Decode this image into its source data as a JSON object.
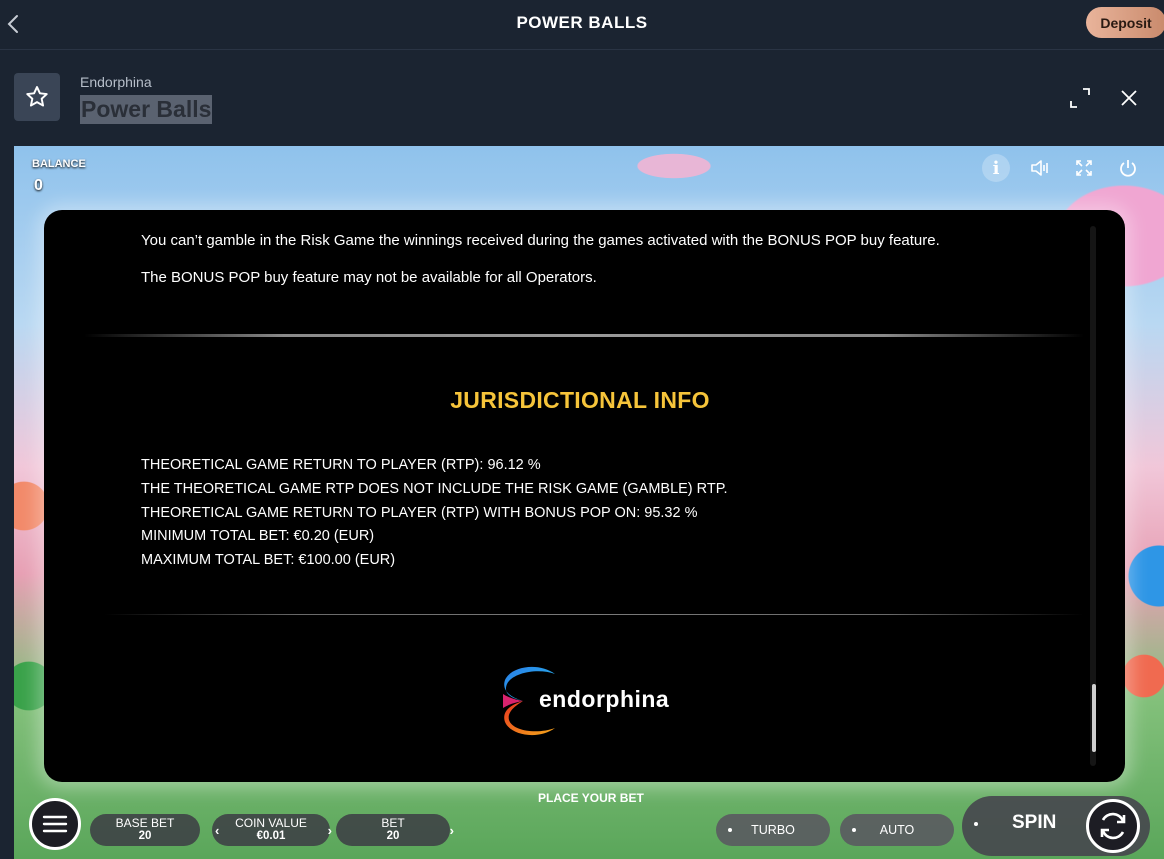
{
  "topbar": {
    "title": "POWER BALLS",
    "deposit_label": "Deposit"
  },
  "header": {
    "provider": "Endorphina",
    "game_name": "Power Balls"
  },
  "game": {
    "balance_label": "BALANCE",
    "balance_value": "0",
    "info_icon_glyph": "i"
  },
  "modal": {
    "paragraphs": [
      "You can’t gamble in the Risk Game the winnings received during the games activated with the BONUS POP buy feature.",
      "The BONUS POP buy feature may not be available for all Operators."
    ],
    "section_title": "JURISDICTIONAL INFO",
    "info_lines": [
      "THEORETICAL GAME RETURN TO PLAYER (RTP): 96.12 %",
      "THE THEORETICAL GAME RTP DOES NOT INCLUDE THE RISK GAME (GAMBLE) RTP.",
      "THEORETICAL GAME RETURN TO PLAYER (RTP) WITH BONUS POP ON: 95.32 %",
      "MINIMUM TOTAL BET: €0.20 (EUR)",
      "MAXIMUM TOTAL BET: €100.00 (EUR)"
    ],
    "logo_text": "endorphina",
    "scroll_position": 0.97
  },
  "controls": {
    "place_bet_label": "PLACE YOUR BET",
    "base_bet": {
      "label": "BASE BET",
      "value": "20"
    },
    "coin_value": {
      "label": "COIN VALUE",
      "value": "€0.01"
    },
    "bet": {
      "label": "BET",
      "value": "20"
    },
    "turbo_label": "TURBO",
    "auto_label": "AUTO",
    "spin_label": "SPIN"
  },
  "colors": {
    "accent_yellow": "#f6c43a",
    "deposit": "#d69c80",
    "background": "#1b2431"
  }
}
